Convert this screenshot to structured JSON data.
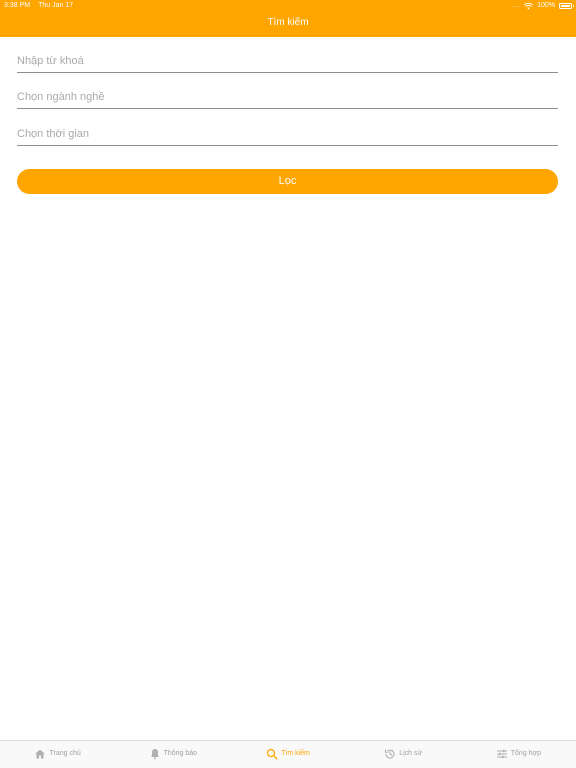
{
  "status_bar": {
    "time": "3:38 PM",
    "date": "Thu Jan 17",
    "signal": "....",
    "battery": "100%"
  },
  "nav": {
    "title": "Tìm kiếm"
  },
  "form": {
    "keyword": {
      "value": "",
      "placeholder": "Nhập từ khoá"
    },
    "industry": {
      "value": "",
      "placeholder": "Chọn ngành nghề"
    },
    "time": {
      "value": "",
      "placeholder": "Chọn thời gian"
    },
    "filter_label": "Lọc"
  },
  "colors": {
    "accent": "#FFA500",
    "tab_inactive": "#A0A0A0"
  },
  "tabs": [
    {
      "label": "Trang chủ",
      "icon": "home-icon",
      "active": false
    },
    {
      "label": "Thông báo",
      "icon": "bell-icon",
      "active": false
    },
    {
      "label": "Tìm kiếm",
      "icon": "search-icon",
      "active": true
    },
    {
      "label": "Lịch sử",
      "icon": "history-icon",
      "active": false
    },
    {
      "label": "Tổng hợp",
      "icon": "sliders-icon",
      "active": false
    }
  ]
}
